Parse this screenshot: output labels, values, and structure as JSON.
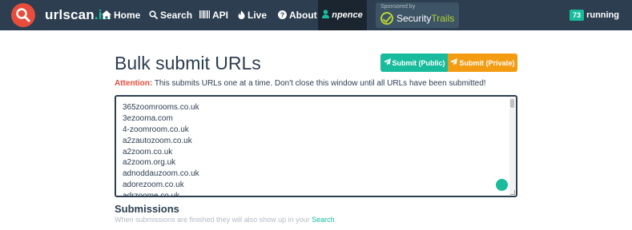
{
  "navbar": {
    "brand": {
      "name": "urlscan",
      "tld": ".io"
    },
    "items": [
      {
        "label": "Home",
        "icon": "home-icon"
      },
      {
        "label": "Search",
        "icon": "search-icon"
      },
      {
        "label": "API",
        "icon": "barcode-icon"
      },
      {
        "label": "Live",
        "icon": "fire-icon"
      },
      {
        "label": "About",
        "icon": "question-circle-icon"
      }
    ],
    "user": {
      "label": "npence",
      "icon": "user-icon"
    },
    "sponsor": {
      "small_text": "Sponsored by",
      "name_part1": "Security",
      "name_part2": "Trails"
    },
    "running": {
      "count": "73",
      "label": "running"
    }
  },
  "main": {
    "title": "Bulk submit URLs",
    "buttons": {
      "public": "Submit (Public)",
      "private": "Submit (Private)"
    },
    "attention": {
      "label": "Attention:",
      "text": " This submits URLs one at a time. Don't close this window until all URLs have been submitted!"
    },
    "urls": [
      "365zoomrooms.co.uk",
      "3ezooma.com",
      "4-zoomroom.co.uk",
      "a2zautozoom.co.uk",
      "a2zoom.co.uk",
      "a2zoom.org.uk",
      "adnoddauzoom.co.uk",
      "adorezoom.co.uk",
      "adrzoome.co.uk"
    ],
    "submissions": {
      "title": "Submissions",
      "text_before": "When submissions are finished they will also show up in your ",
      "link": "Search",
      "text_after": "."
    }
  },
  "colors": {
    "navbar": "#2c3e50",
    "accent": "#18bc9c",
    "warning": "#f39c12",
    "danger": "#e74c3c"
  }
}
